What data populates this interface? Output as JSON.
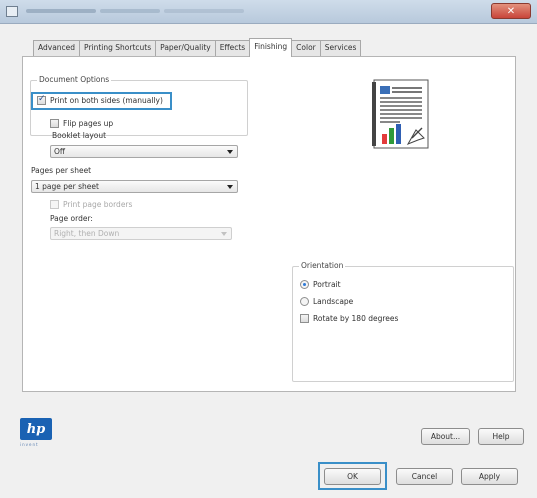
{
  "window": {
    "close_glyph": "✕"
  },
  "tabs": [
    {
      "label": "Advanced",
      "active": false
    },
    {
      "label": "Printing Shortcuts",
      "active": false
    },
    {
      "label": "Paper/Quality",
      "active": false
    },
    {
      "label": "Effects",
      "active": false
    },
    {
      "label": "Finishing",
      "active": true
    },
    {
      "label": "Color",
      "active": false
    },
    {
      "label": "Services",
      "active": false
    }
  ],
  "document_options": {
    "title": "Document Options",
    "print_both_sides": {
      "label": "Print on both sides (manually)",
      "checked": true
    },
    "flip_pages_up": {
      "label": "Flip pages up",
      "checked": false
    },
    "booklet_layout_label": "Booklet layout",
    "booklet_layout_value": "Off",
    "pages_per_sheet_label": "Pages per sheet",
    "pages_per_sheet_value": "1 page per sheet",
    "print_page_borders": {
      "label": "Print page borders",
      "checked": false,
      "disabled": true
    },
    "page_order_label": "Page order:",
    "page_order_value": "Right, then Down"
  },
  "orientation": {
    "title": "Orientation",
    "portrait": {
      "label": "Portrait",
      "selected": true
    },
    "landscape": {
      "label": "Landscape",
      "selected": false
    },
    "rotate": {
      "label": "Rotate by 180 degrees",
      "checked": false
    }
  },
  "preview_icon": "document-preview-icon",
  "logo": {
    "text": "hp",
    "sub": "invent"
  },
  "buttons": {
    "about": "About...",
    "help": "Help",
    "ok": "OK",
    "cancel": "Cancel",
    "apply": "Apply"
  },
  "colors": {
    "highlight": "#3a8fc8",
    "hp_blue": "#1a62b3",
    "close_red": "#c8453a"
  }
}
